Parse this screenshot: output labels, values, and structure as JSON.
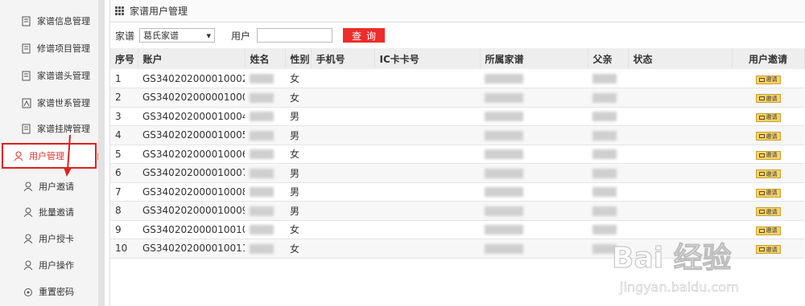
{
  "sidebar": {
    "items": [
      {
        "label": "家谱信息管理",
        "icon": "doc-icon"
      },
      {
        "label": "修谱项目管理",
        "icon": "doc-icon"
      },
      {
        "label": "家谱谱头管理",
        "icon": "doc-icon"
      },
      {
        "label": "家谱世系管理",
        "icon": "tree-icon"
      },
      {
        "label": "家谱挂牌管理",
        "icon": "doc-icon"
      },
      {
        "label": "用户管理",
        "icon": "user-icon",
        "active": true
      },
      {
        "label": "用户邀请",
        "icon": "user-icon"
      },
      {
        "label": "批量邀请",
        "icon": "user-icon"
      },
      {
        "label": "用户授卡",
        "icon": "user-icon"
      },
      {
        "label": "用户操作",
        "icon": "user-icon"
      },
      {
        "label": "重置密码",
        "icon": "reset-icon"
      }
    ]
  },
  "main": {
    "title": "家谱用户管理",
    "filter": {
      "genealogy_label": "家谱",
      "genealogy_value": "葛氏家谱",
      "user_label": "用户",
      "user_value": "",
      "search_button": "查询"
    },
    "table": {
      "headers": [
        "序号",
        "账户",
        "姓名",
        "性别",
        "手机号",
        "IC卡卡号",
        "所属家谱",
        "父亲",
        "状态",
        "用户邀请"
      ],
      "rows": [
        {
          "no": "1",
          "account": "GS340202000010002",
          "gender": "女",
          "invite": "邀请"
        },
        {
          "no": "2",
          "account": "GS3402020000010003",
          "gender": "女",
          "invite": "邀请"
        },
        {
          "no": "3",
          "account": "GS340202000010004",
          "gender": "男",
          "invite": "邀请"
        },
        {
          "no": "4",
          "account": "GS340202000010005",
          "gender": "男",
          "invite": "邀请"
        },
        {
          "no": "5",
          "account": "GS340202000010006",
          "gender": "女",
          "invite": "邀请"
        },
        {
          "no": "6",
          "account": "GS340202000010007",
          "gender": "男",
          "invite": "邀请"
        },
        {
          "no": "7",
          "account": "GS340202000010008",
          "gender": "男",
          "invite": "邀请"
        },
        {
          "no": "8",
          "account": "GS340202000010009",
          "gender": "男",
          "invite": "邀请"
        },
        {
          "no": "9",
          "account": "GS340202000010010",
          "gender": "女",
          "invite": "邀请"
        },
        {
          "no": "10",
          "account": "GS340202000010011",
          "gender": "女",
          "invite": "邀请"
        }
      ]
    }
  },
  "watermark": {
    "brand": "Bai 经验",
    "url": "jingyan.baidu.com"
  },
  "colors": {
    "accent": "#ee2c2c",
    "highlight_border": "#e02020",
    "invite_button": "#f5d36b"
  }
}
